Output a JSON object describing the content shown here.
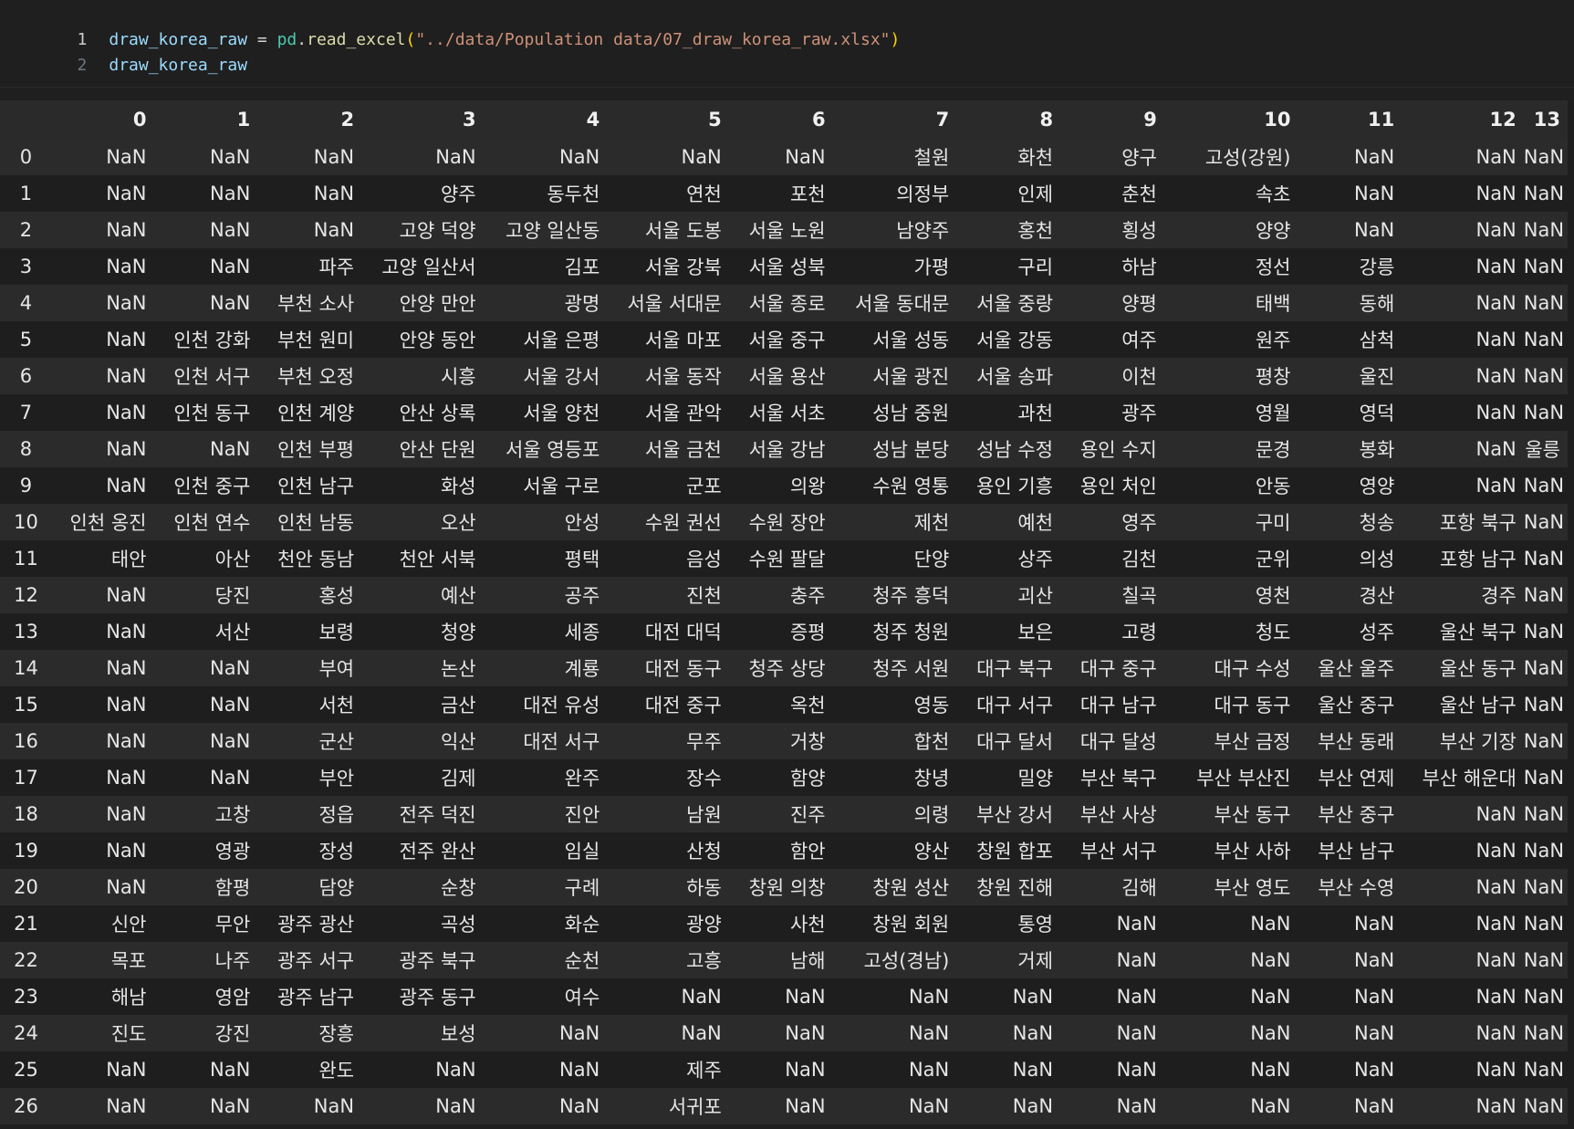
{
  "editor": {
    "lines": [
      {
        "number": "1",
        "tokens": [
          {
            "text": "draw_korea_raw",
            "kind": "var"
          },
          {
            "text": " = ",
            "kind": "op"
          },
          {
            "text": "pd",
            "kind": "mod"
          },
          {
            "text": ".",
            "kind": "op"
          },
          {
            "text": "read_excel",
            "kind": "fn"
          },
          {
            "text": "(",
            "kind": "paren"
          },
          {
            "text": "\"../data/Population data/07_draw_korea_raw.xlsx\"",
            "kind": "str"
          },
          {
            "text": ")",
            "kind": "paren"
          }
        ]
      },
      {
        "number": "2",
        "tokens": [
          {
            "text": "draw_korea_raw",
            "kind": "var"
          }
        ]
      }
    ]
  },
  "dataframe": {
    "index_header": "",
    "columns": [
      "0",
      "1",
      "2",
      "3",
      "4",
      "5",
      "6",
      "7",
      "8",
      "9",
      "10",
      "11",
      "12",
      "13"
    ],
    "rows": [
      {
        "index": "0",
        "cells": [
          "NaN",
          "NaN",
          "NaN",
          "NaN",
          "NaN",
          "NaN",
          "NaN",
          "철원",
          "화천",
          "양구",
          "고성(강원)",
          "NaN",
          "NaN",
          "NaN"
        ]
      },
      {
        "index": "1",
        "cells": [
          "NaN",
          "NaN",
          "NaN",
          "양주",
          "동두천",
          "연천",
          "포천",
          "의정부",
          "인제",
          "춘천",
          "속초",
          "NaN",
          "NaN",
          "NaN"
        ]
      },
      {
        "index": "2",
        "cells": [
          "NaN",
          "NaN",
          "NaN",
          "고양 덕양",
          "고양 일산동",
          "서울 도봉",
          "서울 노원",
          "남양주",
          "홍천",
          "횡성",
          "양양",
          "NaN",
          "NaN",
          "NaN"
        ]
      },
      {
        "index": "3",
        "cells": [
          "NaN",
          "NaN",
          "파주",
          "고양 일산서",
          "김포",
          "서울 강북",
          "서울 성북",
          "가평",
          "구리",
          "하남",
          "정선",
          "강릉",
          "NaN",
          "NaN"
        ]
      },
      {
        "index": "4",
        "cells": [
          "NaN",
          "NaN",
          "부천 소사",
          "안양 만안",
          "광명",
          "서울 서대문",
          "서울 종로",
          "서울 동대문",
          "서울 중랑",
          "양평",
          "태백",
          "동해",
          "NaN",
          "NaN"
        ]
      },
      {
        "index": "5",
        "cells": [
          "NaN",
          "인천 강화",
          "부천 원미",
          "안양 동안",
          "서울 은평",
          "서울 마포",
          "서울 중구",
          "서울 성동",
          "서울 강동",
          "여주",
          "원주",
          "삼척",
          "NaN",
          "NaN"
        ]
      },
      {
        "index": "6",
        "cells": [
          "NaN",
          "인천 서구",
          "부천 오정",
          "시흥",
          "서울 강서",
          "서울 동작",
          "서울 용산",
          "서울 광진",
          "서울 송파",
          "이천",
          "평창",
          "울진",
          "NaN",
          "NaN"
        ]
      },
      {
        "index": "7",
        "cells": [
          "NaN",
          "인천 동구",
          "인천 계양",
          "안산 상록",
          "서울 양천",
          "서울 관악",
          "서울 서초",
          "성남 중원",
          "과천",
          "광주",
          "영월",
          "영덕",
          "NaN",
          "NaN"
        ]
      },
      {
        "index": "8",
        "cells": [
          "NaN",
          "NaN",
          "인천 부평",
          "안산 단원",
          "서울 영등포",
          "서울 금천",
          "서울 강남",
          "성남 분당",
          "성남 수정",
          "용인 수지",
          "문경",
          "봉화",
          "NaN",
          "울릉"
        ]
      },
      {
        "index": "9",
        "cells": [
          "NaN",
          "인천 중구",
          "인천 남구",
          "화성",
          "서울 구로",
          "군포",
          "의왕",
          "수원 영통",
          "용인 기흥",
          "용인 처인",
          "안동",
          "영양",
          "NaN",
          "NaN"
        ]
      },
      {
        "index": "10",
        "cells": [
          "인천 옹진",
          "인천 연수",
          "인천 남동",
          "오산",
          "안성",
          "수원 권선",
          "수원 장안",
          "제천",
          "예천",
          "영주",
          "구미",
          "청송",
          "포항 북구",
          "NaN"
        ]
      },
      {
        "index": "11",
        "cells": [
          "태안",
          "아산",
          "천안 동남",
          "천안 서북",
          "평택",
          "음성",
          "수원 팔달",
          "단양",
          "상주",
          "김천",
          "군위",
          "의성",
          "포항 남구",
          "NaN"
        ]
      },
      {
        "index": "12",
        "cells": [
          "NaN",
          "당진",
          "홍성",
          "예산",
          "공주",
          "진천",
          "충주",
          "청주 흥덕",
          "괴산",
          "칠곡",
          "영천",
          "경산",
          "경주",
          "NaN"
        ]
      },
      {
        "index": "13",
        "cells": [
          "NaN",
          "서산",
          "보령",
          "청양",
          "세종",
          "대전 대덕",
          "증평",
          "청주 청원",
          "보은",
          "고령",
          "청도",
          "성주",
          "울산 북구",
          "NaN"
        ]
      },
      {
        "index": "14",
        "cells": [
          "NaN",
          "NaN",
          "부여",
          "논산",
          "계룡",
          "대전 동구",
          "청주 상당",
          "청주 서원",
          "대구 북구",
          "대구 중구",
          "대구 수성",
          "울산 울주",
          "울산 동구",
          "NaN"
        ]
      },
      {
        "index": "15",
        "cells": [
          "NaN",
          "NaN",
          "서천",
          "금산",
          "대전 유성",
          "대전 중구",
          "옥천",
          "영동",
          "대구 서구",
          "대구 남구",
          "대구 동구",
          "울산 중구",
          "울산 남구",
          "NaN"
        ]
      },
      {
        "index": "16",
        "cells": [
          "NaN",
          "NaN",
          "군산",
          "익산",
          "대전 서구",
          "무주",
          "거창",
          "합천",
          "대구 달서",
          "대구 달성",
          "부산 금정",
          "부산 동래",
          "부산 기장",
          "NaN"
        ]
      },
      {
        "index": "17",
        "cells": [
          "NaN",
          "NaN",
          "부안",
          "김제",
          "완주",
          "장수",
          "함양",
          "창녕",
          "밀양",
          "부산 북구",
          "부산 부산진",
          "부산 연제",
          "부산 해운대",
          "NaN"
        ]
      },
      {
        "index": "18",
        "cells": [
          "NaN",
          "고창",
          "정읍",
          "전주 덕진",
          "진안",
          "남원",
          "진주",
          "의령",
          "부산 강서",
          "부산 사상",
          "부산 동구",
          "부산 중구",
          "NaN",
          "NaN"
        ]
      },
      {
        "index": "19",
        "cells": [
          "NaN",
          "영광",
          "장성",
          "전주 완산",
          "임실",
          "산청",
          "함안",
          "양산",
          "창원 합포",
          "부산 서구",
          "부산 사하",
          "부산 남구",
          "NaN",
          "NaN"
        ]
      },
      {
        "index": "20",
        "cells": [
          "NaN",
          "함평",
          "담양",
          "순창",
          "구례",
          "하동",
          "창원 의창",
          "창원 성산",
          "창원 진해",
          "김해",
          "부산 영도",
          "부산 수영",
          "NaN",
          "NaN"
        ]
      },
      {
        "index": "21",
        "cells": [
          "신안",
          "무안",
          "광주 광산",
          "곡성",
          "화순",
          "광양",
          "사천",
          "창원 회원",
          "통영",
          "NaN",
          "NaN",
          "NaN",
          "NaN",
          "NaN"
        ]
      },
      {
        "index": "22",
        "cells": [
          "목포",
          "나주",
          "광주 서구",
          "광주 북구",
          "순천",
          "고흥",
          "남해",
          "고성(경남)",
          "거제",
          "NaN",
          "NaN",
          "NaN",
          "NaN",
          "NaN"
        ]
      },
      {
        "index": "23",
        "cells": [
          "해남",
          "영암",
          "광주 남구",
          "광주 동구",
          "여수",
          "NaN",
          "NaN",
          "NaN",
          "NaN",
          "NaN",
          "NaN",
          "NaN",
          "NaN",
          "NaN"
        ]
      },
      {
        "index": "24",
        "cells": [
          "진도",
          "강진",
          "장흥",
          "보성",
          "NaN",
          "NaN",
          "NaN",
          "NaN",
          "NaN",
          "NaN",
          "NaN",
          "NaN",
          "NaN",
          "NaN"
        ]
      },
      {
        "index": "25",
        "cells": [
          "NaN",
          "NaN",
          "완도",
          "NaN",
          "NaN",
          "제주",
          "NaN",
          "NaN",
          "NaN",
          "NaN",
          "NaN",
          "NaN",
          "NaN",
          "NaN"
        ]
      },
      {
        "index": "26",
        "cells": [
          "NaN",
          "NaN",
          "NaN",
          "NaN",
          "NaN",
          "서귀포",
          "NaN",
          "NaN",
          "NaN",
          "NaN",
          "NaN",
          "NaN",
          "NaN",
          "NaN"
        ]
      }
    ]
  },
  "colors": {
    "background": "#1f1f1f",
    "odd_row": "#2b2b2b",
    "even_row": "#1e1e1e",
    "text": "#e6e6e6",
    "code_var": "#9cdcfe",
    "code_module": "#4ec9b0",
    "code_function": "#dcdcaa",
    "code_string": "#ce9178",
    "code_paren": "#ffd700",
    "line_number": "#6e7681"
  }
}
